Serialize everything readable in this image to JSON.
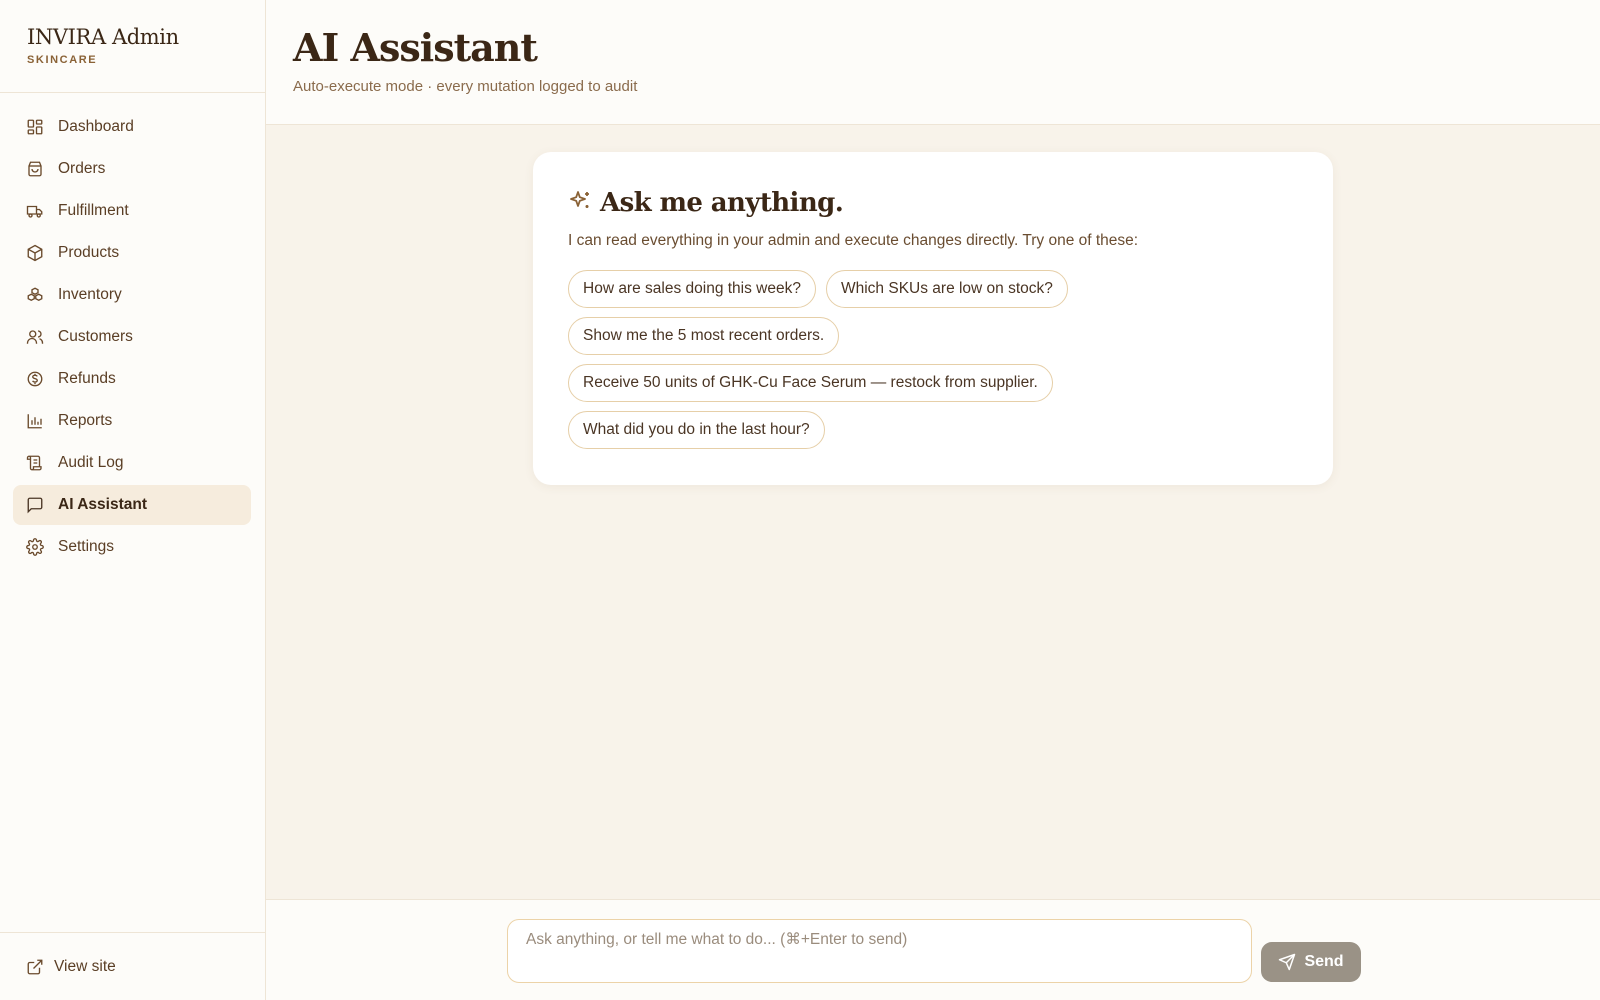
{
  "brand": {
    "title": "INVIRA Admin",
    "subtitle": "SKINCARE"
  },
  "nav": [
    {
      "label": "Dashboard",
      "icon": "dashboard-icon"
    },
    {
      "label": "Orders",
      "icon": "shopping-bag-icon"
    },
    {
      "label": "Fulfillment",
      "icon": "truck-icon"
    },
    {
      "label": "Products",
      "icon": "box-icon"
    },
    {
      "label": "Inventory",
      "icon": "boxes-icon"
    },
    {
      "label": "Customers",
      "icon": "users-icon"
    },
    {
      "label": "Refunds",
      "icon": "dollar-circle-icon"
    },
    {
      "label": "Reports",
      "icon": "bar-chart-icon"
    },
    {
      "label": "Audit Log",
      "icon": "scroll-icon"
    },
    {
      "label": "AI Assistant",
      "icon": "message-square-icon",
      "active": true
    },
    {
      "label": "Settings",
      "icon": "gear-icon"
    }
  ],
  "footer": {
    "view_site": "View site",
    "icon": "external-link-icon"
  },
  "header": {
    "title": "AI Assistant",
    "subtitle": "Auto-execute mode · every mutation logged to audit"
  },
  "card": {
    "title": "Ask me anything.",
    "icon": "sparkles-icon",
    "description": "I can read everything in your admin and execute changes directly. Try one of these:",
    "suggestions": [
      "How are sales doing this week?",
      "Which SKUs are low on stock?",
      "Show me the 5 most recent orders.",
      "Receive 50 units of GHK-Cu Face Serum — restock from supplier.",
      "What did you do in the last hour?"
    ]
  },
  "composer": {
    "placeholder": "Ask anything, or tell me what to do... (⌘+Enter to send)",
    "value": "",
    "send_label": "Send",
    "send_icon": "send-icon"
  },
  "colors": {
    "accent": "#8a6236",
    "background": "#f8f3ea",
    "chip_border": "#e6cfa8",
    "send_button": "#9a9286"
  }
}
